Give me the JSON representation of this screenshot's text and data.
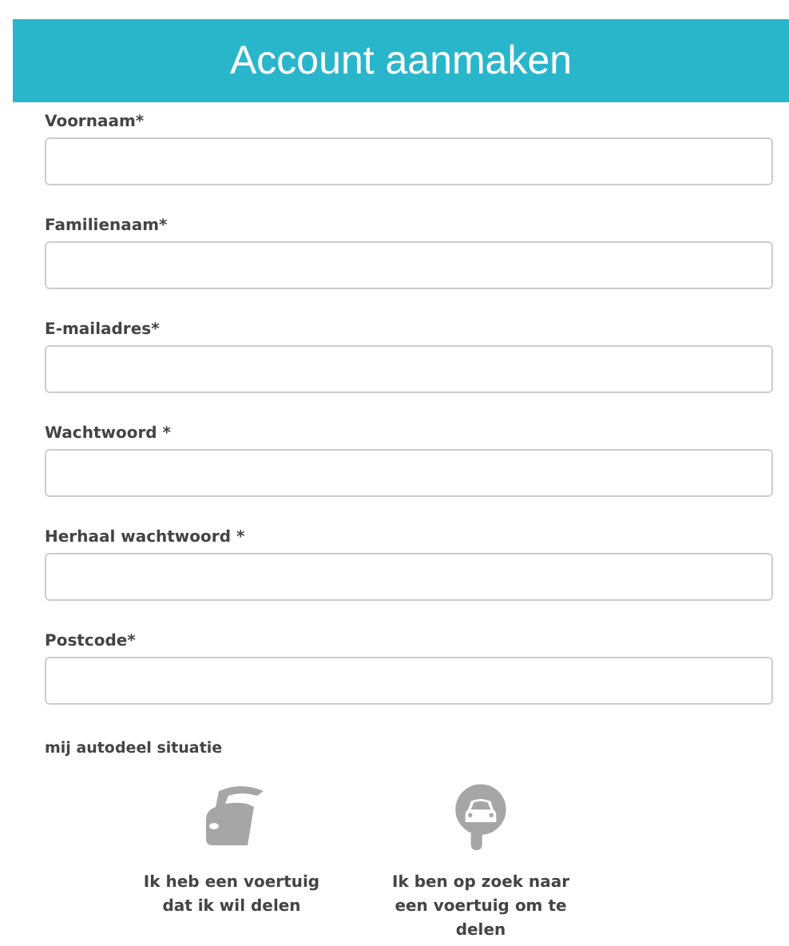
{
  "header": {
    "title": "Account aanmaken"
  },
  "fields": [
    {
      "label": "Voornaam*"
    },
    {
      "label": "Familienaam*"
    },
    {
      "label": "E-mailadres*"
    },
    {
      "label": "Wachtwoord *"
    },
    {
      "label": "Herhaal wachtwoord *"
    },
    {
      "label": "Postcode*"
    }
  ],
  "situation": {
    "label": "mij autodeel situatie",
    "options": [
      {
        "kind": "car",
        "text": "Ik heb een voertuig dat ik wil delen"
      },
      {
        "kind": "search",
        "text": "Ik ben op zoek naar een voertuig om te delen"
      }
    ]
  }
}
